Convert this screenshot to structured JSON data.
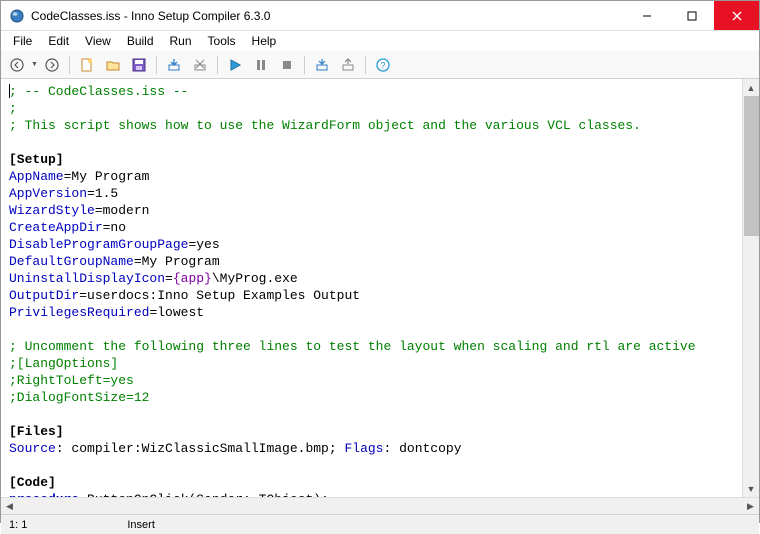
{
  "window": {
    "title": "CodeClasses.iss - Inno Setup Compiler 6.3.0"
  },
  "menu": {
    "items": [
      "File",
      "Edit",
      "View",
      "Build",
      "Run",
      "Tools",
      "Help"
    ]
  },
  "toolbar": {
    "back": "back-icon",
    "forward": "forward-icon",
    "new": "new-icon",
    "open": "open-icon",
    "save": "save-icon",
    "compile": "compile-icon",
    "stop_compile": "stop-compile-icon",
    "run": "run-icon",
    "pause": "pause-icon",
    "stop": "stop-icon",
    "target_down": "target-down-icon",
    "target_up": "target-up-icon",
    "help": "help-icon"
  },
  "code": {
    "l01a": "; -- CodeClasses.iss --",
    "l02a": ";",
    "l03a": "; This script shows how to use the WizardForm object and the various VCL classes.",
    "blank": "",
    "setup": "[Setup]",
    "d1": "AppName",
    "v1": "=My Program",
    "d2": "AppVersion",
    "v2": "=1.5",
    "d3": "WizardStyle",
    "v3": "=modern",
    "d4": "CreateAppDir",
    "v4": "=no",
    "d5": "DisableProgramGroupPage",
    "v5": "=yes",
    "d6": "DefaultGroupName",
    "v6": "=My Program",
    "d7": "UninstallDisplayIcon",
    "v7a": "=",
    "v7const": "{app}",
    "v7b": "\\MyProg.exe",
    "d8": "OutputDir",
    "v8": "=userdocs:Inno Setup Examples Output",
    "d9": "PrivilegesRequired",
    "v9": "=lowest",
    "c2a": "; Uncomment the following three lines to test the layout when scaling and rtl are active",
    "c2b": ";[LangOptions]",
    "c2c": ";RightToLeft=yes",
    "c2d": ";DialogFontSize=12",
    "files": "[Files]",
    "fsrc": "Source",
    "fsrc_v": ": compiler:WizClassicSmallImage.bmp; ",
    "fflags": "Flags",
    "fflags_v": ": dontcopy",
    "codesec": "[Code]",
    "proc": "procedure",
    "proc_rest": " ButtonOnClick(Sender: TObject);"
  },
  "status": {
    "pos": "1:   1",
    "mode": "Insert"
  }
}
